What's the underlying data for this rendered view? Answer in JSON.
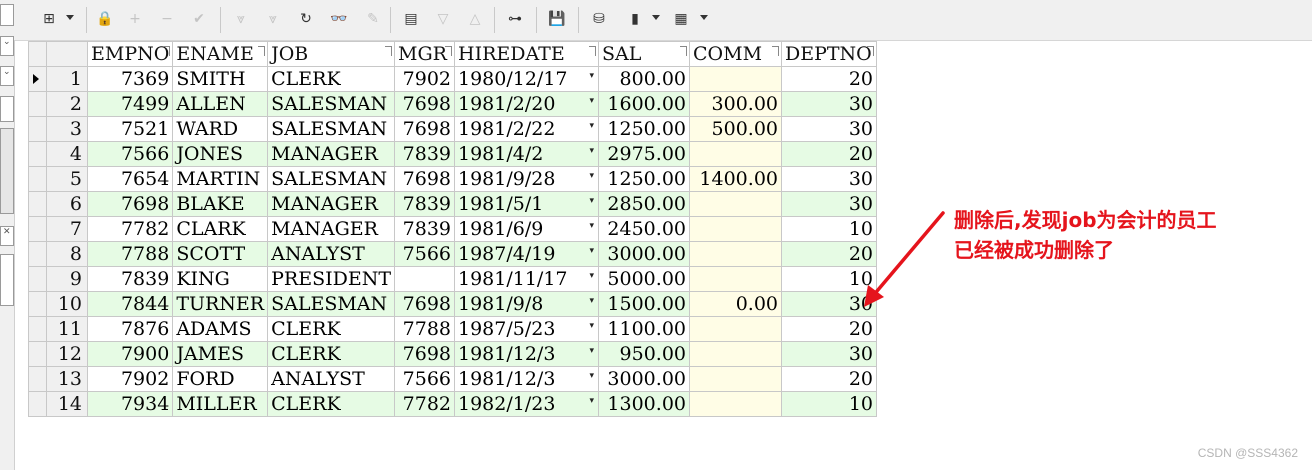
{
  "toolbar": {
    "buttons": [
      {
        "name": "grid-view-button",
        "icon": "grid-icon",
        "glyph": "⊞",
        "enabled": true
      },
      {
        "name": "lock-button",
        "icon": "lock-icon",
        "glyph": "🔒",
        "enabled": true
      },
      {
        "name": "insert-record-button",
        "icon": "plus-icon",
        "glyph": "+",
        "enabled": false
      },
      {
        "name": "delete-record-button",
        "icon": "minus-icon",
        "glyph": "−",
        "enabled": false
      },
      {
        "name": "post-changes-button",
        "icon": "check-icon",
        "glyph": "✔",
        "enabled": false
      },
      {
        "name": "fetch-next-button",
        "icon": "fetch-next-icon",
        "glyph": "⩔",
        "enabled": false
      },
      {
        "name": "fetch-last-button",
        "icon": "fetch-last-icon",
        "glyph": "⩔",
        "enabled": false
      },
      {
        "name": "refresh-button",
        "icon": "refresh-icon",
        "glyph": "↻",
        "enabled": true
      },
      {
        "name": "find-button",
        "icon": "binoculars-icon",
        "glyph": "👓",
        "enabled": true
      },
      {
        "name": "clear-button",
        "icon": "eraser-icon",
        "glyph": "✎",
        "enabled": false
      },
      {
        "name": "export-button",
        "icon": "export-icon",
        "glyph": "▤",
        "enabled": true
      },
      {
        "name": "previous-record-button",
        "icon": "triangle-down-icon",
        "glyph": "▽",
        "enabled": false
      },
      {
        "name": "next-record-button",
        "icon": "triangle-up-icon",
        "glyph": "△",
        "enabled": false
      },
      {
        "name": "query-plan-button",
        "icon": "tree-icon",
        "glyph": "⊶",
        "enabled": true
      },
      {
        "name": "save-button",
        "icon": "floppy-icon",
        "glyph": "💾",
        "enabled": true
      },
      {
        "name": "database-button",
        "icon": "database-icon",
        "glyph": "⛁",
        "enabled": true
      },
      {
        "name": "chart-button",
        "icon": "bar-chart-icon",
        "glyph": "▮",
        "enabled": true
      },
      {
        "name": "table-button",
        "icon": "table-icon",
        "glyph": "▦",
        "enabled": true
      }
    ]
  },
  "grid": {
    "columns": [
      "EMPNO",
      "ENAME",
      "JOB",
      "MGR",
      "HIREDATE",
      "SAL",
      "COMM",
      "DEPTNO"
    ],
    "rows": [
      {
        "num": "1",
        "empno": "7369",
        "ename": "SMITH",
        "job": "CLERK",
        "mgr": "7902",
        "hiredate": "1980/12/17",
        "sal": "800.00",
        "comm": "",
        "deptno": "20"
      },
      {
        "num": "2",
        "empno": "7499",
        "ename": "ALLEN",
        "job": "SALESMAN",
        "mgr": "7698",
        "hiredate": "1981/2/20",
        "sal": "1600.00",
        "comm": "300.00",
        "deptno": "30"
      },
      {
        "num": "3",
        "empno": "7521",
        "ename": "WARD",
        "job": "SALESMAN",
        "mgr": "7698",
        "hiredate": "1981/2/22",
        "sal": "1250.00",
        "comm": "500.00",
        "deptno": "30"
      },
      {
        "num": "4",
        "empno": "7566",
        "ename": "JONES",
        "job": "MANAGER",
        "mgr": "7839",
        "hiredate": "1981/4/2",
        "sal": "2975.00",
        "comm": "",
        "deptno": "20"
      },
      {
        "num": "5",
        "empno": "7654",
        "ename": "MARTIN",
        "job": "SALESMAN",
        "mgr": "7698",
        "hiredate": "1981/9/28",
        "sal": "1250.00",
        "comm": "1400.00",
        "deptno": "30"
      },
      {
        "num": "6",
        "empno": "7698",
        "ename": "BLAKE",
        "job": "MANAGER",
        "mgr": "7839",
        "hiredate": "1981/5/1",
        "sal": "2850.00",
        "comm": "",
        "deptno": "30"
      },
      {
        "num": "7",
        "empno": "7782",
        "ename": "CLARK",
        "job": "MANAGER",
        "mgr": "7839",
        "hiredate": "1981/6/9",
        "sal": "2450.00",
        "comm": "",
        "deptno": "10"
      },
      {
        "num": "8",
        "empno": "7788",
        "ename": "SCOTT",
        "job": "ANALYST",
        "mgr": "7566",
        "hiredate": "1987/4/19",
        "sal": "3000.00",
        "comm": "",
        "deptno": "20"
      },
      {
        "num": "9",
        "empno": "7839",
        "ename": "KING",
        "job": "PRESIDENT",
        "mgr": "",
        "hiredate": "1981/11/17",
        "sal": "5000.00",
        "comm": "",
        "deptno": "10"
      },
      {
        "num": "10",
        "empno": "7844",
        "ename": "TURNER",
        "job": "SALESMAN",
        "mgr": "7698",
        "hiredate": "1981/9/8",
        "sal": "1500.00",
        "comm": "0.00",
        "deptno": "30"
      },
      {
        "num": "11",
        "empno": "7876",
        "ename": "ADAMS",
        "job": "CLERK",
        "mgr": "7788",
        "hiredate": "1987/5/23",
        "sal": "1100.00",
        "comm": "",
        "deptno": "20"
      },
      {
        "num": "12",
        "empno": "7900",
        "ename": "JAMES",
        "job": "CLERK",
        "mgr": "7698",
        "hiredate": "1981/12/3",
        "sal": "950.00",
        "comm": "",
        "deptno": "30"
      },
      {
        "num": "13",
        "empno": "7902",
        "ename": "FORD",
        "job": "ANALYST",
        "mgr": "7566",
        "hiredate": "1981/12/3",
        "sal": "3000.00",
        "comm": "",
        "deptno": "20"
      },
      {
        "num": "14",
        "empno": "7934",
        "ename": "MILLER",
        "job": "CLERK",
        "mgr": "7782",
        "hiredate": "1982/1/23",
        "sal": "1300.00",
        "comm": "",
        "deptno": "10"
      }
    ],
    "current_row": "1"
  },
  "annotation": {
    "line1": "删除后,发现job为会计的员工",
    "line2": "已经被成功删除了",
    "color": "#e5141c"
  },
  "watermark": "CSDN @SSS4362",
  "colors": {
    "row_even": "#e6fbe4",
    "comm_cell": "#fffde6"
  }
}
